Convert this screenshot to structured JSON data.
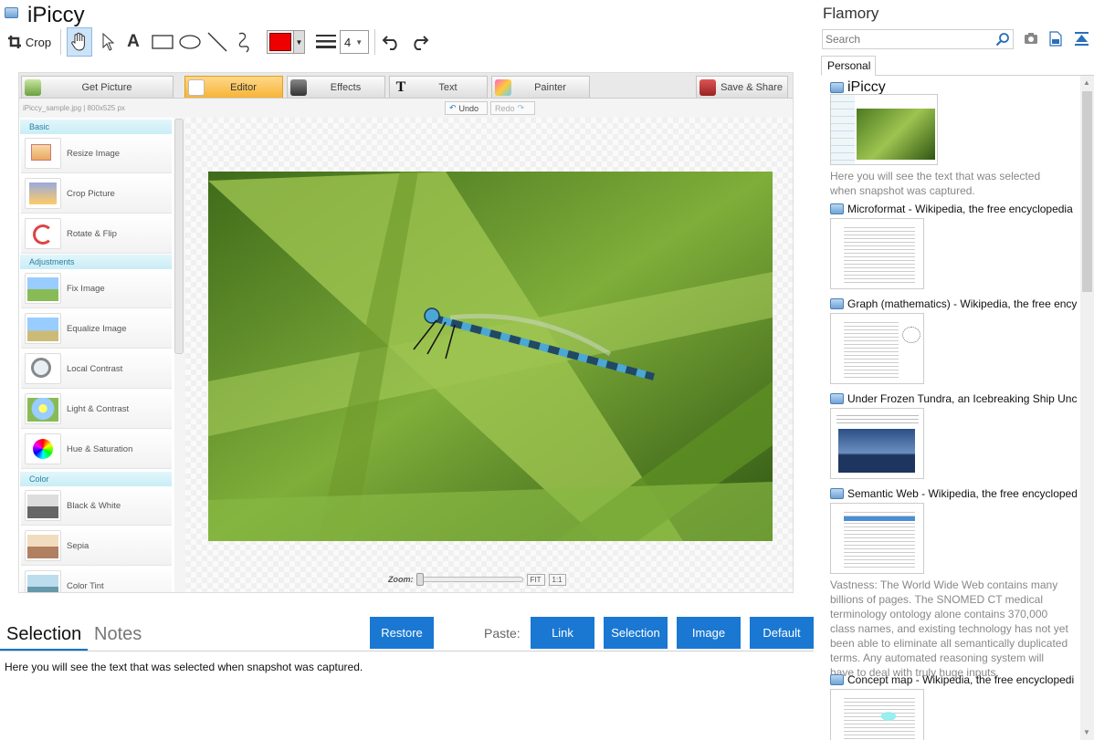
{
  "app": {
    "title": "iPiccy"
  },
  "toolbar": {
    "crop_label": "Crop",
    "text_tool": "A",
    "line_width": "4",
    "color": "#ee0000"
  },
  "editor": {
    "tabs": [
      {
        "label": "Get Picture"
      },
      {
        "label": "Editor"
      },
      {
        "label": "Effects"
      },
      {
        "label": "Text"
      },
      {
        "label": "Painter"
      },
      {
        "label": "Save & Share"
      }
    ],
    "file_info": "iPiccy_sample.jpg | 800x525 px",
    "undo": "Undo",
    "redo": "Redo",
    "sections": [
      {
        "title": "Basic",
        "tools": [
          "Resize Image",
          "Crop Picture",
          "Rotate & Flip"
        ]
      },
      {
        "title": "Adjustments",
        "tools": [
          "Fix Image",
          "Equalize Image",
          "Local Contrast",
          "Light & Contrast",
          "Hue & Saturation"
        ]
      },
      {
        "title": "Color",
        "tools": [
          "Black & White",
          "Sepia",
          "Color Tint"
        ]
      }
    ],
    "zoom": {
      "label": "Zoom:",
      "fit": "FIT",
      "one": "1:1"
    }
  },
  "bottom": {
    "tab_selection": "Selection",
    "tab_notes": "Notes",
    "restore": "Restore",
    "paste_label": "Paste:",
    "paste_link": "Link",
    "paste_selection": "Selection",
    "paste_image": "Image",
    "paste_default": "Default",
    "selection_text": "Here you will see the text that was selected when snapshot was captured."
  },
  "flamory": {
    "title": "Flamory",
    "search_placeholder": "Search",
    "tab_personal": "Personal",
    "entries": [
      {
        "title": "iPiccy",
        "desc": "Here you will see the text that was selected when snapshot was captured."
      },
      {
        "title": "Microformat - Wikipedia, the free encyclopedia",
        "desc": ""
      },
      {
        "title": "Graph (mathematics) - Wikipedia, the free ency",
        "desc": ""
      },
      {
        "title": "Under Frozen Tundra, an Icebreaking Ship Unco",
        "desc": ""
      },
      {
        "title": "Semantic Web - Wikipedia, the free encycloped",
        "desc": "Vastness: The World Wide Web contains many billions of pages. The SNOMED CT medical terminology ontology alone contains 370,000 class names, and existing technology has not yet been able to eliminate all semantically duplicated terms. Any automated reasoning system will have to deal with truly huge inputs."
      },
      {
        "title": "Concept map - Wikipedia, the free encyclopedi",
        "desc": ""
      }
    ]
  }
}
